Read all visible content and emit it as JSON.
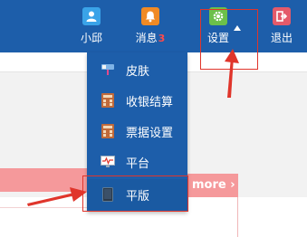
{
  "nav": {
    "items": [
      {
        "label": "小邱",
        "icon": "user-icon"
      },
      {
        "label": "消息",
        "icon": "bell-icon",
        "badge": "3"
      },
      {
        "label": "设置",
        "icon": "gear-icon"
      },
      {
        "label": "退出",
        "icon": "exit-icon"
      }
    ]
  },
  "dropdown": {
    "items": [
      {
        "label": "皮肤",
        "icon": "skin-icon"
      },
      {
        "label": "收银结算",
        "icon": "calculator-icon"
      },
      {
        "label": "票据设置",
        "icon": "receipt-icon"
      },
      {
        "label": "平台",
        "icon": "monitor-icon"
      },
      {
        "label": "平版",
        "icon": "tablet-icon"
      }
    ]
  },
  "content": {
    "more_text": "more ›"
  },
  "colors": {
    "nav_bg": "#1d5eaa",
    "annotation": "#e0352b",
    "banner": "#f5999b"
  }
}
